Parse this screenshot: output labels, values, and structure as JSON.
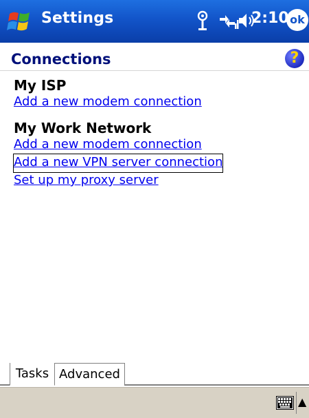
{
  "titlebar": {
    "title": "Settings",
    "time": "2:10",
    "ok_label": "ok",
    "icons": [
      "windows-start-icon",
      "antenna-icon",
      "connectivity-icon",
      "speaker-icon"
    ]
  },
  "header": {
    "title": "Connections",
    "help_icon": "help-icon",
    "help_glyph": "?"
  },
  "sections": [
    {
      "heading": "My ISP",
      "links": [
        "Add a new modem connection"
      ]
    },
    {
      "heading": "My Work Network",
      "links": [
        "Add a new modem connection",
        "Add a new VPN server connection",
        "Set up my proxy server"
      ]
    }
  ],
  "focused_link": "Add a new VPN server connection",
  "tabs": [
    {
      "label": "Tasks",
      "active": true
    },
    {
      "label": "Advanced",
      "active": false
    }
  ],
  "menubar": {
    "icons": [
      "keyboard-icon",
      "up-arrow-icon"
    ],
    "arrow_glyph": "▲"
  },
  "colors": {
    "titlebar": "#1254c9",
    "link": "#0000ee",
    "header_text": "#00107a",
    "menubar": "#d8d2c5"
  }
}
